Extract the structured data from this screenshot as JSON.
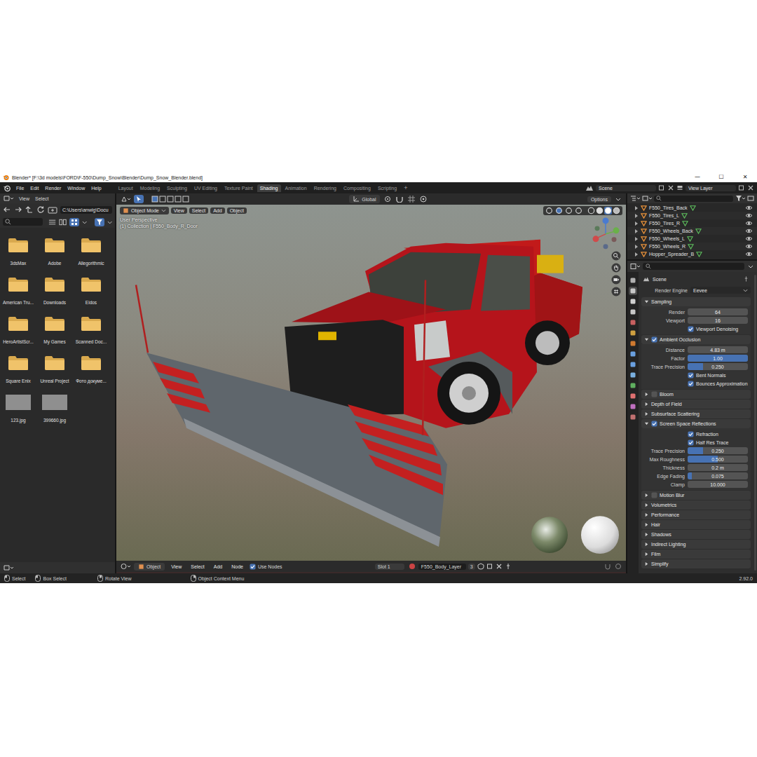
{
  "window": {
    "title": "Blender* [F:\\3d models\\FORD\\F-550\\Dump_Snow\\Blender\\Dump_Snow_Blender.blend]",
    "controls": [
      "—",
      "☐",
      "✕"
    ]
  },
  "menu": [
    "File",
    "Edit",
    "Render",
    "Window",
    "Help"
  ],
  "workspaces": [
    {
      "label": "Layout",
      "selected": false
    },
    {
      "label": "Modeling",
      "selected": false
    },
    {
      "label": "Sculpting",
      "selected": false
    },
    {
      "label": "UV Editing",
      "selected": false
    },
    {
      "label": "Texture Paint",
      "selected": false
    },
    {
      "label": "Shading",
      "selected": true
    },
    {
      "label": "Animation",
      "selected": false
    },
    {
      "label": "Rendering",
      "selected": false
    },
    {
      "label": "Compositing",
      "selected": false
    },
    {
      "label": "Scripting",
      "selected": false
    }
  ],
  "workspace_add": "+",
  "scene": "Scene",
  "view_layer": "View Layer",
  "file_browser": {
    "menu": [
      "View",
      "Select"
    ],
    "path": "C:\\Users\\anwig\\Docu",
    "items": [
      {
        "name": "3dsMax",
        "kind": "folder"
      },
      {
        "name": "Adobe",
        "kind": "folder"
      },
      {
        "name": "Allegorithmic",
        "kind": "folder"
      },
      {
        "name": "American Tru...",
        "kind": "folder"
      },
      {
        "name": "Downloads",
        "kind": "folder"
      },
      {
        "name": "Eidos",
        "kind": "folder"
      },
      {
        "name": "HeroArtistScr...",
        "kind": "folder"
      },
      {
        "name": "My Games",
        "kind": "folder"
      },
      {
        "name": "Scanned Doc...",
        "kind": "folder"
      },
      {
        "name": "Square Enix",
        "kind": "folder"
      },
      {
        "name": "Unreal Project",
        "kind": "folder"
      },
      {
        "name": "Фото докуме...",
        "kind": "folder"
      },
      {
        "name": "123.jpg",
        "kind": "image"
      },
      {
        "name": "399660.jpg",
        "kind": "image"
      }
    ]
  },
  "viewport": {
    "mode": "Object Mode",
    "menu": [
      "View",
      "Select",
      "Add",
      "Object"
    ],
    "orientation": "Global",
    "options": "Options",
    "perspective": "User Perspective",
    "collection": "(1) Collection | F550_Body_R_Door"
  },
  "shader_editor": {
    "object_type": "Object",
    "menu": [
      "View",
      "Select",
      "Add",
      "Node"
    ],
    "use_nodes": {
      "label": "Use Nodes",
      "checked": true
    },
    "slot": "Slot 1",
    "material": "F550_Body_Layer",
    "users": "3"
  },
  "outliner": {
    "items": [
      {
        "name": "F550_Tires_Back",
        "visible": true
      },
      {
        "name": "F550_Tires_L",
        "visible": true
      },
      {
        "name": "F550_Tires_R",
        "visible": true
      },
      {
        "name": "F550_Wheels_Back",
        "visible": true
      },
      {
        "name": "F550_Wheels_L",
        "visible": true
      },
      {
        "name": "F550_Wheels_R",
        "visible": true
      },
      {
        "name": "Hopper_Spreader_B",
        "visible": true
      }
    ]
  },
  "properties": {
    "context": "Scene",
    "render_engine": {
      "label": "Render Engine",
      "value": "Eevee"
    },
    "panels": [
      {
        "label": "Sampling",
        "kind": "plain",
        "checked": false,
        "expanded": true,
        "rows": [
          {
            "kind": "number",
            "label": "Render",
            "value": "64"
          },
          {
            "kind": "number",
            "label": "Viewport",
            "value": "16"
          },
          {
            "kind": "check",
            "label": "Viewport Denoising",
            "checked": true
          }
        ]
      },
      {
        "label": "Ambient Occlusion",
        "kind": "toggle",
        "checked": true,
        "expanded": true,
        "rows": [
          {
            "kind": "number",
            "label": "Distance",
            "value": "4.83 m"
          },
          {
            "kind": "slider",
            "label": "Factor",
            "value": "1.00",
            "level": 1
          },
          {
            "kind": "slider",
            "label": "Trace Precision",
            "value": "0.250",
            "level": 0.25
          },
          {
            "kind": "check",
            "label": "Bent Normals",
            "checked": true
          },
          {
            "kind": "check",
            "label": "Bounces Approximation",
            "checked": true
          }
        ]
      },
      {
        "label": "Bloom",
        "kind": "toggle",
        "checked": false,
        "expanded": false,
        "rows": []
      },
      {
        "label": "Depth of Field",
        "kind": "plain",
        "checked": false,
        "expanded": false,
        "rows": []
      },
      {
        "label": "Subsurface Scattering",
        "kind": "plain",
        "checked": false,
        "expanded": false,
        "rows": []
      },
      {
        "label": "Screen Space Reflections",
        "kind": "toggle",
        "checked": true,
        "expanded": true,
        "rows": [
          {
            "kind": "check",
            "label": "Refraction",
            "checked": true
          },
          {
            "kind": "check",
            "label": "Half Res Trace",
            "checked": true
          },
          {
            "kind": "slider",
            "label": "Trace Precision",
            "value": "0.250",
            "level": 0.25
          },
          {
            "kind": "slider",
            "label": "Max Roughness",
            "value": "0.500",
            "level": 0.5
          },
          {
            "kind": "number",
            "label": "Thickness",
            "value": "0.2 m"
          },
          {
            "kind": "slider",
            "label": "Edge Fading",
            "value": "0.075",
            "level": 0.075
          },
          {
            "kind": "number",
            "label": "Clamp",
            "value": "10.000"
          }
        ]
      },
      {
        "label": "Motion Blur",
        "kind": "toggle",
        "checked": false,
        "expanded": false,
        "rows": []
      },
      {
        "label": "Volumetrics",
        "kind": "plain",
        "checked": false,
        "expanded": false,
        "rows": []
      },
      {
        "label": "Performance",
        "kind": "plain",
        "checked": false,
        "expanded": false,
        "rows": []
      },
      {
        "label": "Hair",
        "kind": "plain",
        "checked": false,
        "expanded": false,
        "rows": []
      },
      {
        "label": "Shadows",
        "kind": "plain",
        "checked": false,
        "expanded": false,
        "rows": []
      },
      {
        "label": "Indirect Lighting",
        "kind": "plain",
        "checked": false,
        "expanded": false,
        "rows": []
      },
      {
        "label": "Film",
        "kind": "plain",
        "checked": false,
        "expanded": false,
        "rows": []
      },
      {
        "label": "Simplify",
        "kind": "plain",
        "checked": false,
        "expanded": false,
        "rows": []
      }
    ]
  },
  "status_bar": {
    "items": [
      "Select",
      "Box Select",
      "Rotate View",
      "Object Context Menu"
    ],
    "version": "2.92.0"
  }
}
